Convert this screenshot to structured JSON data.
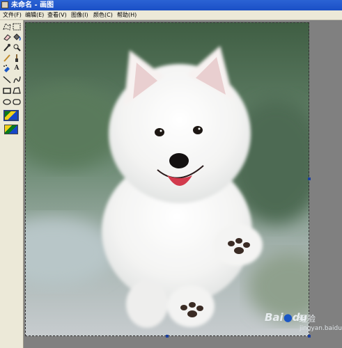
{
  "window": {
    "title": "未命名 - 画图"
  },
  "menu": [
    {
      "label": "文件(F)"
    },
    {
      "label": "编辑(E)"
    },
    {
      "label": "查看(V)"
    },
    {
      "label": "图像(I)"
    },
    {
      "label": "颜色(C)"
    },
    {
      "label": "帮助(H)"
    }
  ],
  "tools": [
    {
      "icon": "free-select-icon"
    },
    {
      "icon": "rect-select-icon"
    },
    {
      "icon": "eraser-icon"
    },
    {
      "icon": "fill-icon"
    },
    {
      "icon": "color-picker-icon"
    },
    {
      "icon": "magnifier-icon"
    },
    {
      "icon": "pencil-icon"
    },
    {
      "icon": "brush-icon"
    },
    {
      "icon": "airbrush-icon"
    },
    {
      "icon": "text-icon",
      "glyph": "A"
    },
    {
      "icon": "line-icon"
    },
    {
      "icon": "curve-icon"
    },
    {
      "icon": "rectangle-icon"
    },
    {
      "icon": "polygon-icon"
    },
    {
      "icon": "ellipse-icon"
    },
    {
      "icon": "rounded-rect-icon"
    }
  ],
  "canvas": {
    "image": "white-samoyed-puppy-running-photo",
    "background": "#5f7d63"
  },
  "watermark": {
    "brand": "Bai",
    "brand_suffix": "du",
    "sub": "经验",
    "url": "jingyan.baidu.com"
  }
}
